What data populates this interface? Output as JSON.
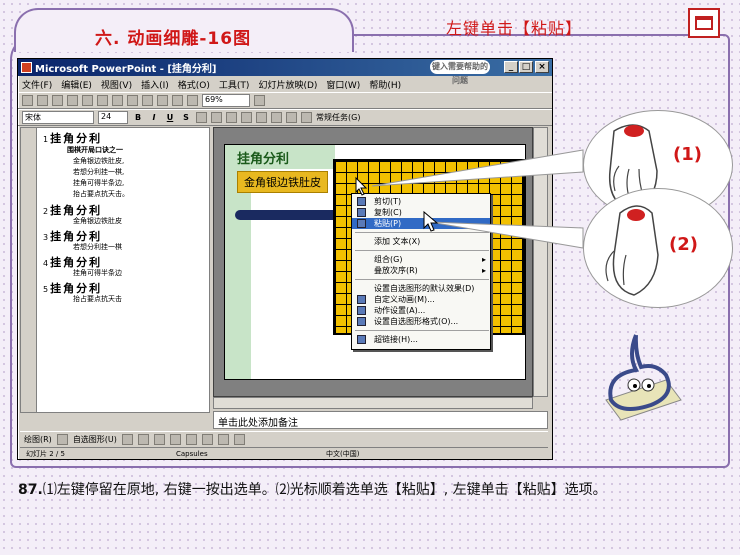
{
  "header": {
    "slide_title": "六. 动画细雕-16图",
    "instruction": "左键单击【粘贴】"
  },
  "window": {
    "title": "Microsoft PowerPoint - [挂角分利]",
    "ask_box": "键入需要帮助的问题",
    "controls": [
      "_",
      "□",
      "×"
    ],
    "menu": [
      "文件(F)",
      "编辑(E)",
      "视图(V)",
      "插入(I)",
      "格式(O)",
      "工具(T)",
      "幻灯片放映(D)",
      "窗口(W)",
      "帮助(H)"
    ],
    "zoom": "69%",
    "font_name": "宋体",
    "font_size": "24",
    "tasks_label": "常规任务(G)"
  },
  "outline": [
    {
      "num": "1",
      "title": "挂角分利",
      "subs": [
        "围棋开局口诀之一",
        "金角银边铁肚皮,",
        "若想分利挂一棋,",
        "挂角可得半条边,",
        "抬占要点抗天击。"
      ]
    },
    {
      "num": "2",
      "title": "挂角分利",
      "subs": [
        "金角银边铁肚皮"
      ]
    },
    {
      "num": "3",
      "title": "挂角分利",
      "subs": [
        "若想分利挂一棋"
      ]
    },
    {
      "num": "4",
      "title": "挂角分利",
      "subs": [
        "挂角可得半条边"
      ]
    },
    {
      "num": "5",
      "title": "挂角分利",
      "subs": [
        "抬占要点抗天击"
      ]
    }
  ],
  "slide": {
    "heading": "挂角分利",
    "tagline": "金角银边铁肚皮"
  },
  "context_menu": {
    "items": [
      {
        "label": "剪切(T)",
        "selected": false,
        "icon": "scissors-icon"
      },
      {
        "label": "复制(C)",
        "selected": false,
        "icon": "copy-icon"
      },
      {
        "label": "粘贴(P)",
        "selected": true,
        "icon": "paste-icon"
      },
      {
        "label": "添加 文本(X)",
        "selected": false,
        "icon": ""
      },
      {
        "label": "组合(G)",
        "selected": false,
        "icon": "",
        "submenu": true
      },
      {
        "label": "叠放次序(R)",
        "selected": false,
        "icon": "",
        "submenu": true
      },
      {
        "label": "设置自选图形的默认效果(D)",
        "selected": false,
        "icon": ""
      },
      {
        "label": "自定义动画(M)...",
        "selected": false,
        "icon": "animation-icon"
      },
      {
        "label": "动作设置(A)...",
        "selected": false,
        "icon": "action-icon"
      },
      {
        "label": "设置自选图形格式(O)...",
        "selected": false,
        "icon": "format-icon"
      },
      {
        "label": "超链接(H)...",
        "selected": false,
        "icon": "hyperlink-icon"
      }
    ]
  },
  "notes_placeholder": "单击此处添加备注",
  "drawbar": {
    "draw": "绘图(R)",
    "autoshapes": "自选图形(U)"
  },
  "status": {
    "slide": "幻灯片 2 / 5",
    "design": "Capsules",
    "lang": "中文(中国)"
  },
  "steps": {
    "one": "(1)",
    "two": "(2)"
  },
  "caption": {
    "number": "87.",
    "text": "⑴左键停留在原地, 右键一按出选单。⑵光标顺着选单选【粘贴】, 左键单击【粘贴】选项。"
  },
  "colors": {
    "accent": "#d01818",
    "frame": "#8a6fae",
    "grid": "#f2c000",
    "menu_select": "#316ac5"
  }
}
